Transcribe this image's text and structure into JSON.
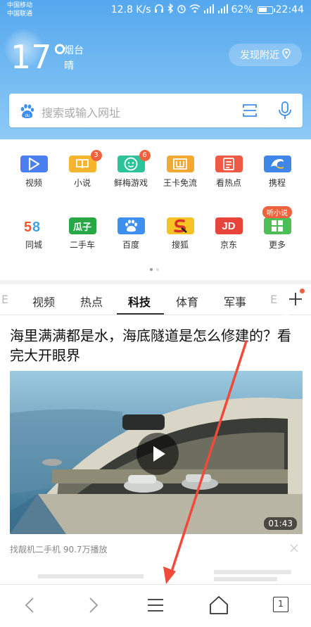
{
  "status": {
    "carrier1": "中国移动",
    "carrier2": "中国联通",
    "speed": "12.8 K/s",
    "battery": "62%",
    "battery_level": 0.62,
    "time": "22:44"
  },
  "weather": {
    "temperature": "17°",
    "city": "烟台",
    "condition": "晴",
    "nearby_label": "发现附近"
  },
  "search": {
    "placeholder": "搜索或输入网址"
  },
  "apps": [
    {
      "label": "视频",
      "color": "#4a7ff0",
      "icon": "play-icon"
    },
    {
      "label": "小说",
      "color": "#f5b52e",
      "icon": "book-icon",
      "badge": "3"
    },
    {
      "label": "鲜梅游戏",
      "color": "#2cc39a",
      "icon": "game-icon",
      "badge": "6"
    },
    {
      "label": "王卡免流",
      "color": "#f3a833",
      "icon": "card-icon"
    },
    {
      "label": "看热点",
      "color": "#ef5a47",
      "icon": "news-icon"
    },
    {
      "label": "携程",
      "color": "#3f86e8",
      "icon": "dolphin-icon"
    },
    {
      "label": "同城",
      "color": "#ffffff",
      "icon": "58-logo",
      "logo_text": "58"
    },
    {
      "label": "二手车",
      "color": "#28a745",
      "icon": "guazi-logo",
      "logo_text": "瓜子"
    },
    {
      "label": "百度",
      "color": "#3d8ff0",
      "icon": "paw-icon"
    },
    {
      "label": "搜狐",
      "color": "#f6c224",
      "icon": "sohu-logo"
    },
    {
      "label": "京东",
      "color": "#e9443a",
      "icon": "jd-logo",
      "logo_text": "JD"
    },
    {
      "label": "更多",
      "color": "#4cbe56",
      "icon": "grid-icon",
      "badge_text": "听小说"
    }
  ],
  "tabs": [
    {
      "label": "视频"
    },
    {
      "label": "热点"
    },
    {
      "label": "科技",
      "active": true
    },
    {
      "label": "体育"
    },
    {
      "label": "军事"
    }
  ],
  "article": {
    "headline": "海里满满都是水，海底隧道是怎么修建的？看完大开眼界",
    "duration": "01:43",
    "meta": "找靓机二手机 90.7万播放"
  },
  "bottom_nav": {
    "tab_count": "1"
  }
}
